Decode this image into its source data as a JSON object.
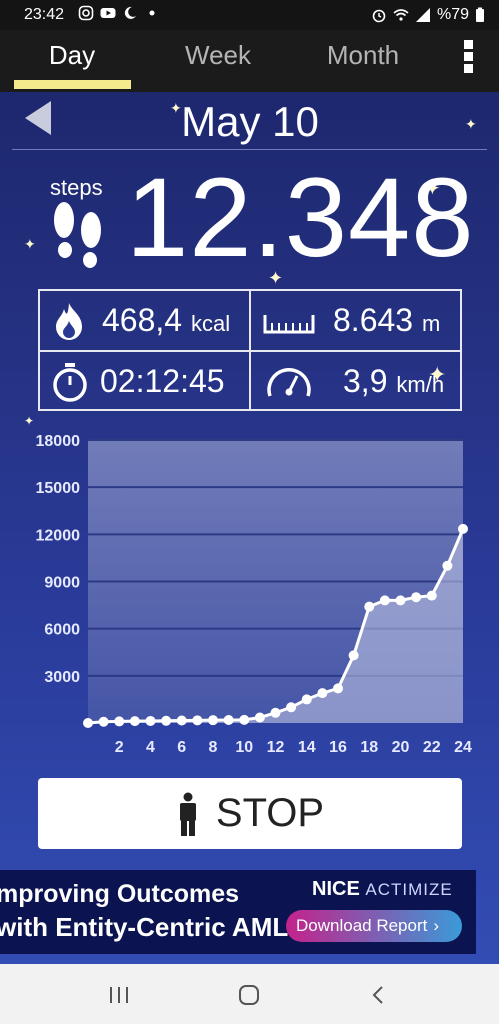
{
  "status_bar": {
    "time": "23:42",
    "battery": "%79"
  },
  "tabs": [
    {
      "label": "Day"
    },
    {
      "label": "Week"
    },
    {
      "label": "Month"
    }
  ],
  "date": "May 10",
  "steps": {
    "label": "steps",
    "value": "12.348"
  },
  "stats": {
    "calories": {
      "value": "468,4",
      "unit": "kcal"
    },
    "distance": {
      "value": "8.643",
      "unit": "m"
    },
    "duration": {
      "value": "02:12:45"
    },
    "speed": {
      "value": "3,9",
      "unit": "km/h"
    }
  },
  "chart_data": {
    "type": "area",
    "x": [
      0,
      1,
      2,
      3,
      4,
      5,
      6,
      7,
      8,
      9,
      10,
      11,
      12,
      13,
      14,
      15,
      16,
      17,
      18,
      19,
      20,
      21,
      22,
      23,
      24
    ],
    "y": [
      0,
      80,
      100,
      120,
      130,
      140,
      160,
      170,
      180,
      190,
      200,
      350,
      650,
      1000,
      1500,
      1900,
      2200,
      4300,
      7400,
      7800,
      7800,
      8000,
      8100,
      10000,
      12348
    ],
    "xticks": [
      2,
      4,
      6,
      8,
      10,
      12,
      14,
      16,
      18,
      20,
      22,
      24
    ],
    "yticks": [
      3000,
      6000,
      9000,
      12000,
      15000,
      18000
    ],
    "ylim": [
      0,
      18000
    ],
    "xlim": [
      0,
      24
    ],
    "grid": true
  },
  "stop_button": {
    "label": "STOP"
  },
  "ad": {
    "line1": "mproving Outcomes",
    "line2": "with Entity-Centric AML",
    "brand": "NICE",
    "brand_sub": "ACTIMIZE",
    "cta": "Download Report"
  },
  "colors": {
    "tab_underline": "#f4ec8c",
    "chart_fill": "#a9b1d8",
    "chart_line": "#ffffff"
  }
}
